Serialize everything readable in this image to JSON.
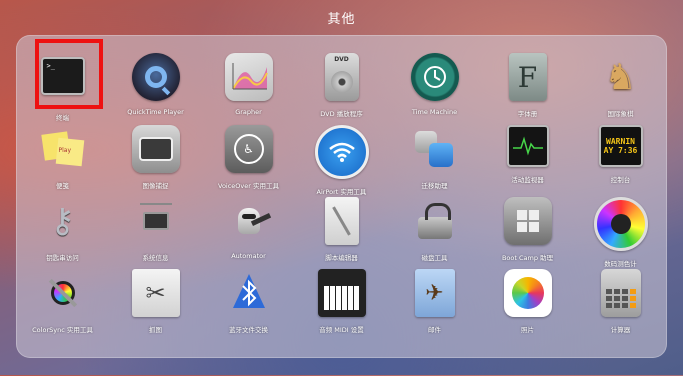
{
  "folder_title": "其他",
  "apps": [
    {
      "label": "终端",
      "icon": "terminal-icon"
    },
    {
      "label": "QuickTime Player",
      "icon": "quicktime-icon"
    },
    {
      "label": "Grapher",
      "icon": "grapher-icon"
    },
    {
      "label": "DVD 播放程序",
      "icon": "dvd-player-icon"
    },
    {
      "label": "Time Machine",
      "icon": "time-machine-icon"
    },
    {
      "label": "字体册",
      "icon": "font-book-icon"
    },
    {
      "label": "国际象棋",
      "icon": "chess-icon"
    },
    {
      "label": "便笺",
      "icon": "stickies-icon"
    },
    {
      "label": "图像捕捉",
      "icon": "image-capture-icon"
    },
    {
      "label": "VoiceOver 实用工具",
      "icon": "voiceover-icon"
    },
    {
      "label": "AirPort 实用工具",
      "icon": "airport-icon"
    },
    {
      "label": "迁移助理",
      "icon": "migration-assistant-icon"
    },
    {
      "label": "活动监视器",
      "icon": "activity-monitor-icon"
    },
    {
      "label": "控制台",
      "icon": "console-icon"
    },
    {
      "label": "钥匙串访问",
      "icon": "keychain-icon"
    },
    {
      "label": "系统信息",
      "icon": "system-information-icon"
    },
    {
      "label": "Automator",
      "icon": "automator-icon"
    },
    {
      "label": "脚本编辑器",
      "icon": "script-editor-icon"
    },
    {
      "label": "磁盘工具",
      "icon": "disk-utility-icon"
    },
    {
      "label": "Boot Camp 助理",
      "icon": "boot-camp-icon"
    },
    {
      "label": "数码测色计",
      "icon": "color-meter-icon"
    },
    {
      "label": "ColorSync 实用工具",
      "icon": "colorsync-icon"
    },
    {
      "label": "抓图",
      "icon": "grab-icon"
    },
    {
      "label": "蓝牙文件交换",
      "icon": "bluetooth-icon"
    },
    {
      "label": "音频 MIDI 设置",
      "icon": "audio-midi-icon"
    },
    {
      "label": "邮件",
      "icon": "mail-icon"
    },
    {
      "label": "照片",
      "icon": "photos-icon"
    },
    {
      "label": "计算器",
      "icon": "calculator-icon"
    }
  ],
  "console_text": [
    "WARNIN",
    "AY 7:36"
  ],
  "stickies_text": "Play",
  "colors": {
    "highlight": "#ee1111"
  }
}
